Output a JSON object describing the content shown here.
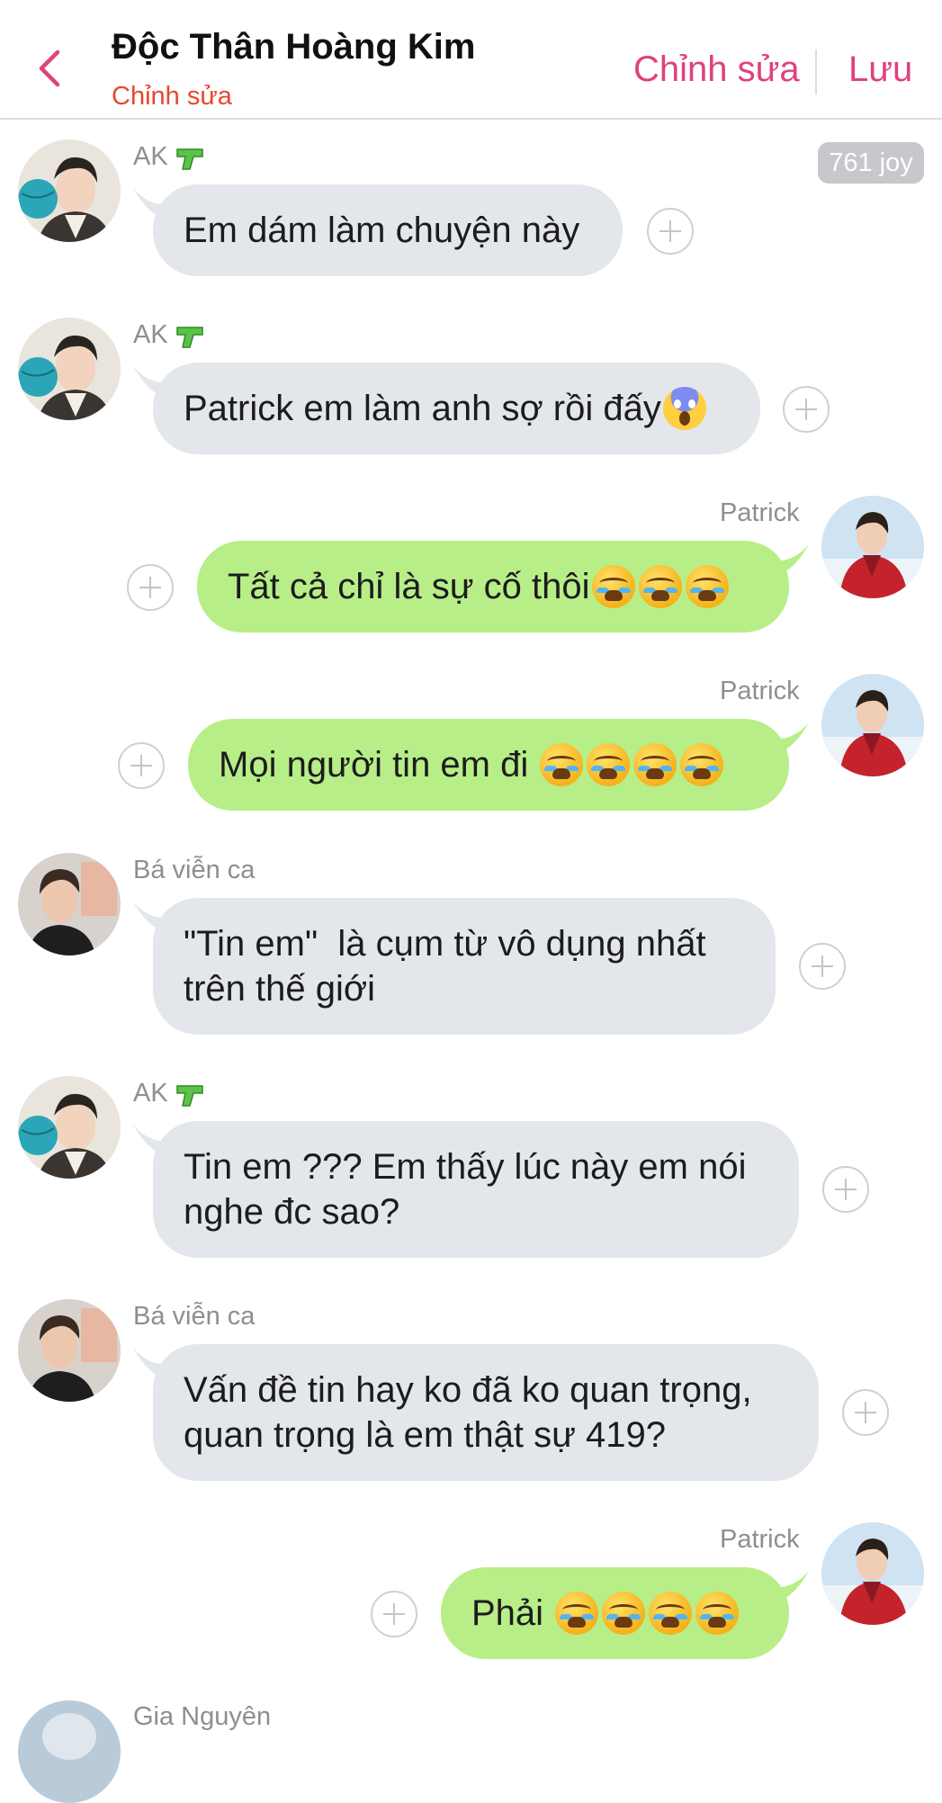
{
  "header": {
    "title": "Độc Thân Hoàng Kim",
    "subtitle": "Chỉnh sửa",
    "edit_label": "Chỉnh sửa",
    "save_label": "Lưu"
  },
  "joy_badge": "761 joy",
  "messages": [
    {
      "sender": "AK",
      "side": "left",
      "avatar": "avatar-ak",
      "text": "Em dám làm chuyện này",
      "emojis": []
    },
    {
      "sender": "AK",
      "side": "left",
      "avatar": "avatar-ak",
      "text": "Patrick em làm anh sợ rồi đấy",
      "emojis": [
        "scream"
      ]
    },
    {
      "sender": "Patrick",
      "side": "right",
      "avatar": "avatar-patrick",
      "text": "Tất cả chỉ là sự cố thôi",
      "emojis": [
        "loudly-crying",
        "loudly-crying",
        "loudly-crying"
      ]
    },
    {
      "sender": "Patrick",
      "side": "right",
      "avatar": "avatar-patrick",
      "text": "Mọi người tin em đi",
      "emojis": [
        "loudly-crying",
        "loudly-crying",
        "loudly-crying",
        "loudly-crying"
      ]
    },
    {
      "sender": "Bá viễn ca",
      "side": "left",
      "avatar": "avatar-ba-vien-ca",
      "text": "\"Tin em\"  là cụm từ vô dụng nhất trên thế giới",
      "emojis": []
    },
    {
      "sender": "AK",
      "side": "left",
      "avatar": "avatar-ak",
      "text": "Tin em ??? Em thấy lúc này em nói nghe đc sao?",
      "emojis": []
    },
    {
      "sender": "Bá viễn ca",
      "side": "left",
      "avatar": "avatar-ba-vien-ca",
      "text": "Vấn đề tin hay ko đã ko quan trọng, quan trọng là em thật sự 419?",
      "emojis": []
    },
    {
      "sender": "Patrick",
      "side": "right",
      "avatar": "avatar-patrick",
      "text": "Phải ",
      "emojis": [
        "loudly-crying",
        "loudly-crying",
        "loudly-crying",
        "loudly-crying"
      ]
    }
  ],
  "next_sender": "Gia Nguyên",
  "icons": {
    "back": "chevron-left-icon",
    "add_reaction": "plus-circle-icon",
    "sender_badge": "water-gun-icon"
  },
  "colors": {
    "accent": "#e0417e",
    "subtitle": "#e8472e",
    "bubble_left": "#e3e6ea",
    "bubble_right": "#b8ee87"
  }
}
